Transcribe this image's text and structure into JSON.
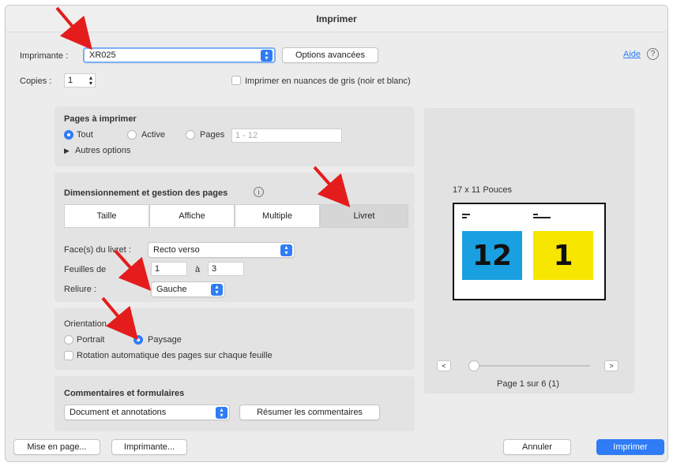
{
  "window": {
    "title": "Imprimer"
  },
  "printer": {
    "label": "Imprimante :",
    "value": "XR025",
    "advanced_button": "Options avancées",
    "help_link": "Aide",
    "help_icon": "help-circle-icon"
  },
  "copies": {
    "label": "Copies :",
    "value": "1",
    "grayscale_label": "Imprimer en nuances de gris (noir et blanc)"
  },
  "pages": {
    "title": "Pages à imprimer",
    "opt_all": "Tout",
    "opt_active": "Active",
    "opt_pages": "Pages",
    "range_placeholder": "1 - 12",
    "more": "Autres options"
  },
  "sizing": {
    "title": "Dimensionnement et gestion des pages",
    "info_icon": "info-icon",
    "tabs": [
      "Taille",
      "Affiche",
      "Multiple",
      "Livret"
    ],
    "active_tab": "Livret",
    "sides_label": "Face(s) du livret :",
    "sides_value": "Recto verso",
    "sheets_label": "Feuilles de",
    "sheets_from": "1",
    "sheets_to_label": "à",
    "sheets_to": "3",
    "binding_label": "Reliure :",
    "binding_value": "Gauche"
  },
  "orientation": {
    "title": "Orientation",
    "portrait": "Portrait",
    "landscape": "Paysage",
    "auto_rotate": "Rotation automatique des pages sur chaque feuille"
  },
  "comments": {
    "title": "Commentaires et formulaires",
    "value": "Document et annotations",
    "summarize_button": "Résumer les commentaires"
  },
  "preview": {
    "size_label": "17 x 11 Pouces",
    "left_page": "12",
    "right_page": "1",
    "left_color": "#1aa0e0",
    "right_color": "#f7e600",
    "prev": "<",
    "next": ">",
    "page_label": "Page 1 sur 6 (1)",
    "slider_position": 0
  },
  "footer": {
    "page_setup": "Mise en page...",
    "printer_btn": "Imprimante...",
    "cancel": "Annuler",
    "print": "Imprimer"
  },
  "colors": {
    "accent": "#2f7cf6",
    "arrow": "#e41c1c"
  }
}
